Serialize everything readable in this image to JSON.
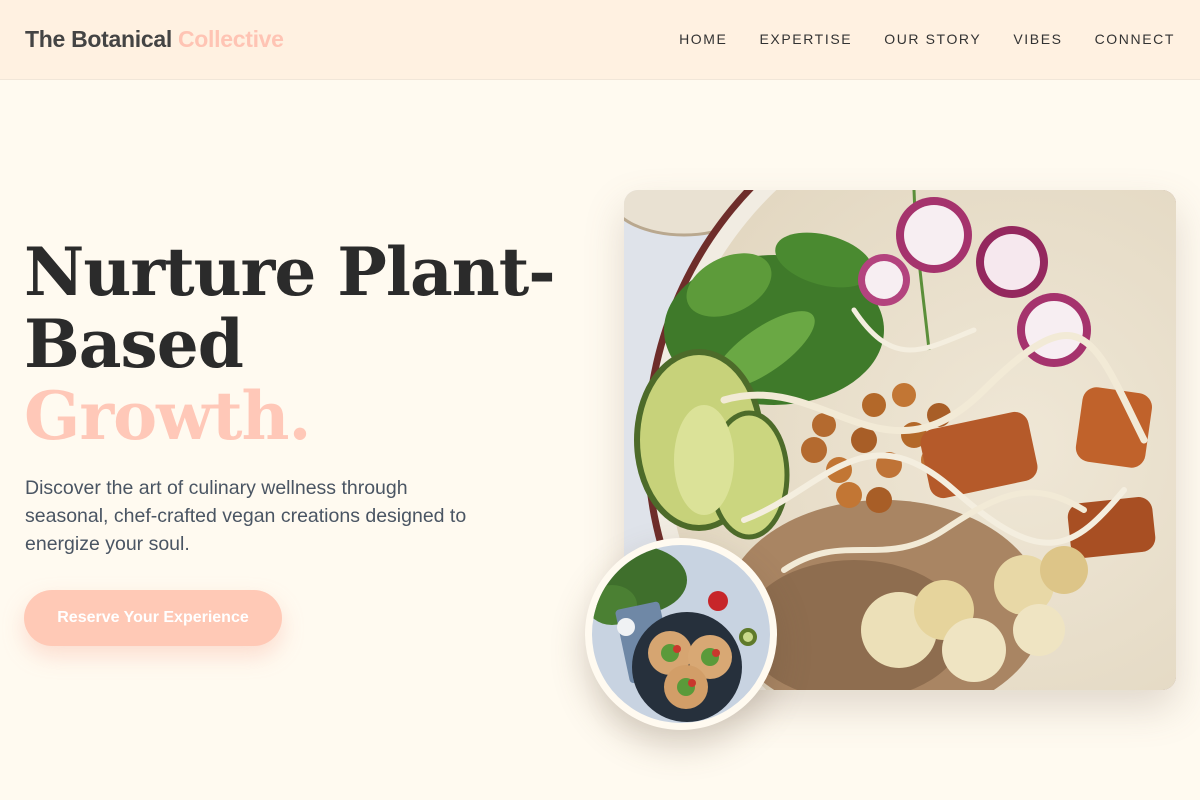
{
  "brand": {
    "name_main": "The Botanical",
    "name_accent": "Collective"
  },
  "nav": {
    "items": [
      {
        "label": "HOME"
      },
      {
        "label": "EXPERTISE"
      },
      {
        "label": "OUR STORY"
      },
      {
        "label": "VIBES"
      },
      {
        "label": "CONNECT"
      }
    ]
  },
  "hero": {
    "title_line1": "Nurture Plant-",
    "title_line2": "Based",
    "title_highlight": "Growth.",
    "description": "Discover the art of culinary wellness through seasonal, chef-crafted vegan creations designed to energize your soul.",
    "cta_label": "Reserve Your Experience"
  },
  "colors": {
    "page_bg": "#fffaf0",
    "header_bg": "#fff1e1",
    "accent": "#ffc4b4",
    "text_dark": "#2b2b2b",
    "text_muted": "#4a5563"
  },
  "images": {
    "main": "vegan-bowl-photo",
    "thumbnail": "tacos-plate-photo"
  }
}
